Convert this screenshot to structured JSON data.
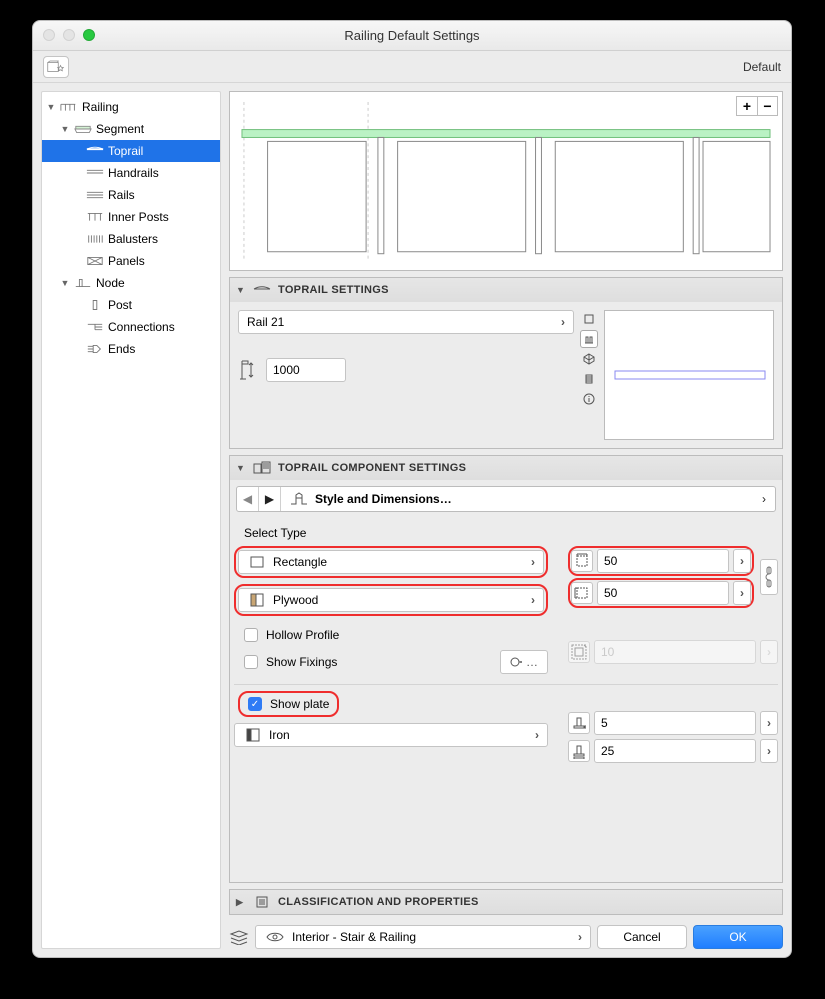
{
  "window": {
    "title": "Railing Default Settings",
    "mode": "Default"
  },
  "tree": {
    "railing": "Railing",
    "segment": "Segment",
    "seg_items": [
      "Toprail",
      "Handrails",
      "Rails",
      "Inner Posts",
      "Balusters",
      "Panels"
    ],
    "node": "Node",
    "node_items": [
      "Post",
      "Connections",
      "Ends"
    ]
  },
  "sections": {
    "toprail_settings": "TOPRAIL SETTINGS",
    "component": "TOPRAIL COMPONENT SETTINGS",
    "class": "CLASSIFICATION AND PROPERTIES"
  },
  "toprail": {
    "rail_name": "Rail 21",
    "height": "1000"
  },
  "component": {
    "nav": "Style and Dimensions…",
    "select_type": "Select Type",
    "shape": "Rectangle",
    "material": "Plywood",
    "hollow": "Hollow Profile",
    "fixings": "Show Fixings",
    "show_plate": "Show plate",
    "plate_mat": "Iron",
    "dim_w": "50",
    "dim_h": "50",
    "dim_off": "10",
    "plate_h": "5",
    "plate_w": "25"
  },
  "footer": {
    "layer": "Interior - Stair & Railing",
    "cancel": "Cancel",
    "ok": "OK"
  }
}
